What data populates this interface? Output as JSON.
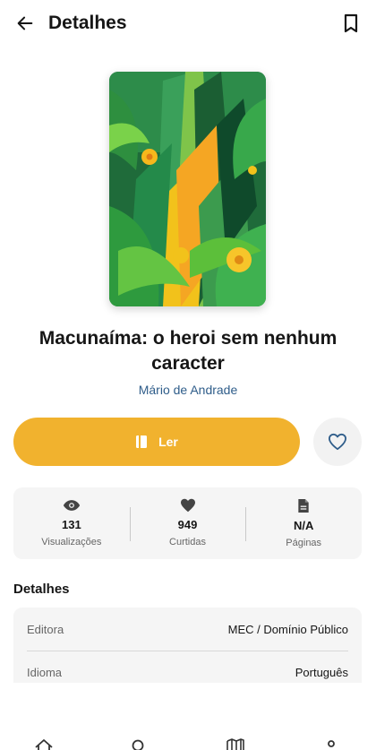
{
  "header": {
    "title": "Detalhes",
    "back_icon": "arrow-left-icon",
    "bookmark_icon": "bookmark-outline-icon"
  },
  "book": {
    "title": "Macunaíma: o heroi sem nenhum caracter",
    "author": "Mário de Andrade",
    "cover_description": "jungle-abstract-cover-art"
  },
  "actions": {
    "read_label": "Ler",
    "read_icon": "book-icon",
    "favorite_icon": "heart-outline-icon",
    "accent_color": "#f1b22e"
  },
  "stats": [
    {
      "icon": "eye-icon",
      "value": "131",
      "label": "Visualizações"
    },
    {
      "icon": "heart-filled-icon",
      "value": "949",
      "label": "Curtidas"
    },
    {
      "icon": "document-icon",
      "value": "N/A",
      "label": "Páginas"
    }
  ],
  "details": {
    "section_title": "Detalhes",
    "rows": [
      {
        "key": "Editora",
        "value": "MEC / Domínio Público"
      },
      {
        "key": "Idioma",
        "value": "Português"
      }
    ]
  },
  "bottom_nav": {
    "items": [
      {
        "icon": "home-icon"
      },
      {
        "icon": "search-icon"
      },
      {
        "icon": "library-icon"
      },
      {
        "icon": "profile-icon"
      }
    ]
  }
}
